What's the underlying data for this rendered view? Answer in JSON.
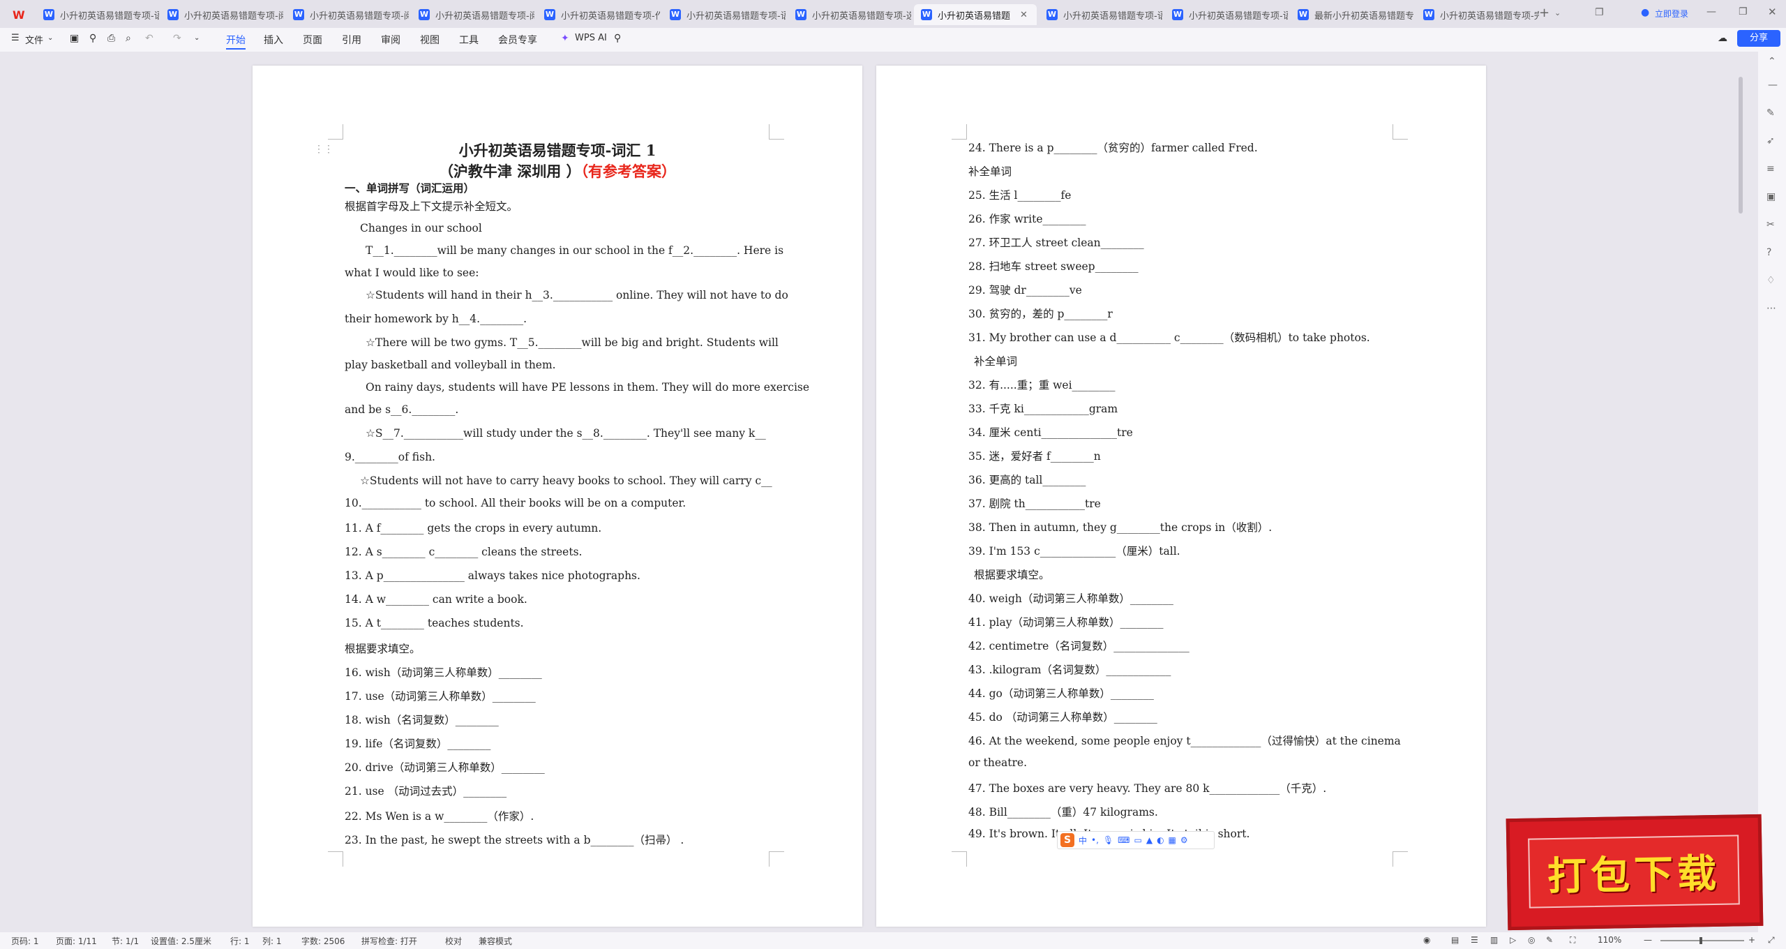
{
  "tabs": [
    {
      "label": "小升初英语易错题专项-语"
    },
    {
      "label": "小升初英语易错题专项-阅"
    },
    {
      "label": "小升初英语易错题专项-阅"
    },
    {
      "label": "小升初英语易错题专项-阅"
    },
    {
      "label": "小升初英语易错题专项-作"
    },
    {
      "label": "小升初英语易错题专项-语"
    },
    {
      "label": "小升初英语易错题专项-选"
    },
    {
      "label": "小升初英语易错题"
    },
    {
      "label": "小升初英语易错题专项-语"
    },
    {
      "label": "小升初英语易错题专项-语"
    },
    {
      "label": "最新小升初英语易错题专"
    },
    {
      "label": "小升初英语易错题专项-完"
    }
  ],
  "login_label": "立即登录",
  "toolbar": {
    "file": "文件",
    "menus": [
      "开始",
      "插入",
      "页面",
      "引用",
      "审阅",
      "视图",
      "工具",
      "会员专享"
    ],
    "wps_ai": "WPS AI",
    "share": "分享"
  },
  "doc": {
    "title_line1": "小升初英语易错题专项-词汇 1",
    "title_line2": "（沪教牛津  深圳用 ）",
    "title_red": "（有参考答案）",
    "section1": "一、单词拼写（词汇运用）",
    "page1_lines": [
      "根据首字母及上下文提示补全短文。",
      "Changes in our school",
      "T__1.________will be many changes in our school in the f__2.________. Here is",
      "what I would like to see:",
      "☆Students will hand in their h__3.___________ online. They will not have to do",
      "their homework by h__4.________.",
      "☆There will be two gyms. T__5.________will be big and bright. Students will",
      "play basketball and volleyball in them.",
      "On rainy days, students will have PE lessons in them. They will do more exercise",
      "and be s__6.________.",
      "☆S__7.___________will study under the s__8.________. They'll see many k__",
      "9.________of fish.",
      "☆Students will not have to carry heavy books to school. They will carry c__",
      "10.___________ to school. All their books will be on a computer.",
      "11.   A f________    gets the crops in every autumn.",
      "12.   A s________   c________   cleans the streets.",
      "13.   A p_______________   always takes nice photographs.",
      "14.   A w________   can write a book.",
      "15.   A t________   teaches students.",
      "根据要求填空。",
      "16.   wish（动词第三人称单数）________",
      "17.   use（动词第三人称单数）________",
      "18.   wish（名词复数）________",
      "19.   life（名词复数）________",
      "20.   drive（动词第三人称单数）________",
      "21.   use （动词过去式）________",
      "22.   Ms Wen is a w________（作家）.",
      "23.   In the past, he swept the streets with a b________（扫帚） ."
    ],
    "page2_lines": [
      "24.   There is a p________（贫穷的）farmer called Fred.",
      "补全单词",
      "25.   生活 l________fe",
      "26.   作家 write________",
      "27.   环卫工人 street clean________",
      "28.   扫地车  street sweep________",
      "29.   驾驶  dr________ve",
      "30.   贫穷的，差的    p________r",
      "31.   My brother can use a d__________   c________（数码相机）to take photos.",
      "补全单词",
      "32.   有.....重；重 wei________",
      "33.   千克 ki____________gram",
      "34.   厘米 centi______________tre",
      "35.   迷，爱好者  f________n",
      "36.   更高的     tall________",
      "37.   剧院    th___________tre",
      "38.    Then in autumn, they g________the crops in（收割）.",
      "39.    I'm 153 c______________（厘米）tall.",
      "根据要求填空。",
      "40.   weigh（动词第三人称单数）________",
      "41.   play（动词第三人称单数）________",
      "42.   centimetre（名词复数）______________",
      "43.   .kilogram（名词复数）____________",
      "44.   go（动词第三人称单数）________",
      "45.   do （动词第三人称单数）________",
      "46.   At the weekend, some people enjoy t_____________（过得愉快）at the cinema",
      "or theatre.",
      "47.    The boxes are very heavy. They are 80 k_____________（千克）.",
      "48.    Bill________（重）47 kilograms.",
      "49.   It's brown. It                                  all. Its nose is big. Its tail is short."
    ]
  },
  "ime": {
    "logo": "S",
    "lang": "中"
  },
  "banner_text": "打包下载",
  "status": {
    "page_code": "页码: 1",
    "page": "页面: 1/11",
    "section": "节: 1/1",
    "setting": "设置值: 2.5厘米",
    "row": "行: 1",
    "col": "列: 1",
    "words": "字数: 2506",
    "spell": "拼写检查: 打开",
    "proof": "校对",
    "compat": "兼容模式",
    "zoom": "110%"
  }
}
